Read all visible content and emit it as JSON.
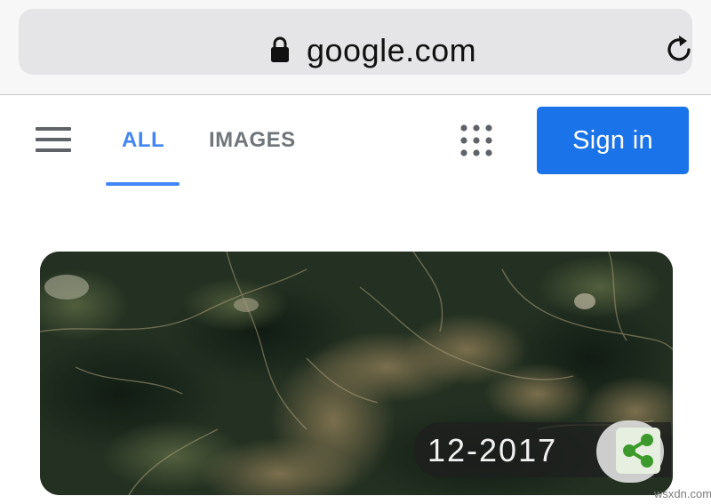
{
  "browser": {
    "url": "google.com",
    "lock_icon": "lock-icon",
    "reload_icon": "reload-icon"
  },
  "nav": {
    "menu_icon": "hamburger-menu-icon",
    "tabs": [
      {
        "label": "ALL",
        "active": true
      },
      {
        "label": "IMAGES",
        "active": false
      }
    ],
    "apps_icon": "apps-grid-icon",
    "signin_label": "Sign in",
    "accent_color": "#4285f4",
    "button_color": "#1a73e8"
  },
  "card": {
    "date_label": "12-2017",
    "share_icon": "share-icon",
    "share_color": "#3c9a2c"
  },
  "watermark": "wsxdn.com"
}
